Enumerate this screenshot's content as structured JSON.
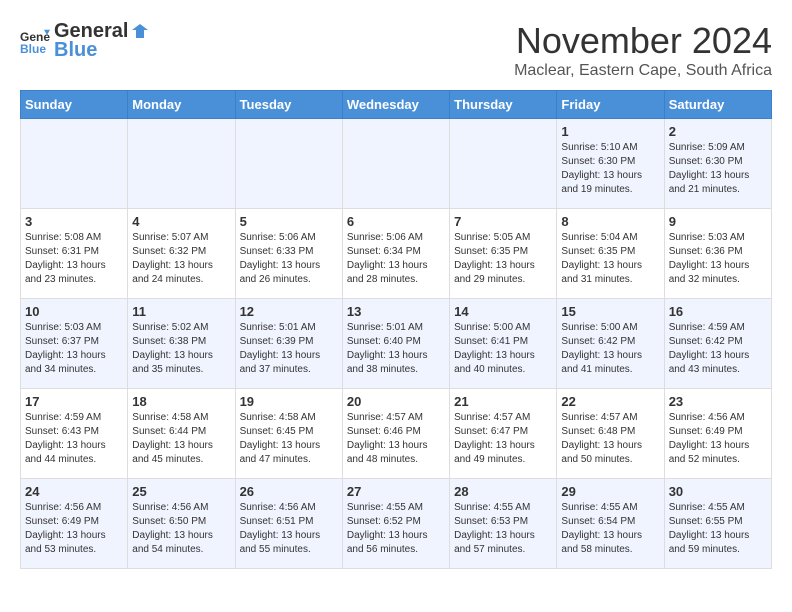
{
  "logo": {
    "general": "General",
    "blue": "Blue"
  },
  "title": "November 2024",
  "subtitle": "Maclear, Eastern Cape, South Africa",
  "weekdays": [
    "Sunday",
    "Monday",
    "Tuesday",
    "Wednesday",
    "Thursday",
    "Friday",
    "Saturday"
  ],
  "weeks": [
    [
      {
        "day": "",
        "info": ""
      },
      {
        "day": "",
        "info": ""
      },
      {
        "day": "",
        "info": ""
      },
      {
        "day": "",
        "info": ""
      },
      {
        "day": "",
        "info": ""
      },
      {
        "day": "1",
        "info": "Sunrise: 5:10 AM\nSunset: 6:30 PM\nDaylight: 13 hours\nand 19 minutes."
      },
      {
        "day": "2",
        "info": "Sunrise: 5:09 AM\nSunset: 6:30 PM\nDaylight: 13 hours\nand 21 minutes."
      }
    ],
    [
      {
        "day": "3",
        "info": "Sunrise: 5:08 AM\nSunset: 6:31 PM\nDaylight: 13 hours\nand 23 minutes."
      },
      {
        "day": "4",
        "info": "Sunrise: 5:07 AM\nSunset: 6:32 PM\nDaylight: 13 hours\nand 24 minutes."
      },
      {
        "day": "5",
        "info": "Sunrise: 5:06 AM\nSunset: 6:33 PM\nDaylight: 13 hours\nand 26 minutes."
      },
      {
        "day": "6",
        "info": "Sunrise: 5:06 AM\nSunset: 6:34 PM\nDaylight: 13 hours\nand 28 minutes."
      },
      {
        "day": "7",
        "info": "Sunrise: 5:05 AM\nSunset: 6:35 PM\nDaylight: 13 hours\nand 29 minutes."
      },
      {
        "day": "8",
        "info": "Sunrise: 5:04 AM\nSunset: 6:35 PM\nDaylight: 13 hours\nand 31 minutes."
      },
      {
        "day": "9",
        "info": "Sunrise: 5:03 AM\nSunset: 6:36 PM\nDaylight: 13 hours\nand 32 minutes."
      }
    ],
    [
      {
        "day": "10",
        "info": "Sunrise: 5:03 AM\nSunset: 6:37 PM\nDaylight: 13 hours\nand 34 minutes."
      },
      {
        "day": "11",
        "info": "Sunrise: 5:02 AM\nSunset: 6:38 PM\nDaylight: 13 hours\nand 35 minutes."
      },
      {
        "day": "12",
        "info": "Sunrise: 5:01 AM\nSunset: 6:39 PM\nDaylight: 13 hours\nand 37 minutes."
      },
      {
        "day": "13",
        "info": "Sunrise: 5:01 AM\nSunset: 6:40 PM\nDaylight: 13 hours\nand 38 minutes."
      },
      {
        "day": "14",
        "info": "Sunrise: 5:00 AM\nSunset: 6:41 PM\nDaylight: 13 hours\nand 40 minutes."
      },
      {
        "day": "15",
        "info": "Sunrise: 5:00 AM\nSunset: 6:42 PM\nDaylight: 13 hours\nand 41 minutes."
      },
      {
        "day": "16",
        "info": "Sunrise: 4:59 AM\nSunset: 6:42 PM\nDaylight: 13 hours\nand 43 minutes."
      }
    ],
    [
      {
        "day": "17",
        "info": "Sunrise: 4:59 AM\nSunset: 6:43 PM\nDaylight: 13 hours\nand 44 minutes."
      },
      {
        "day": "18",
        "info": "Sunrise: 4:58 AM\nSunset: 6:44 PM\nDaylight: 13 hours\nand 45 minutes."
      },
      {
        "day": "19",
        "info": "Sunrise: 4:58 AM\nSunset: 6:45 PM\nDaylight: 13 hours\nand 47 minutes."
      },
      {
        "day": "20",
        "info": "Sunrise: 4:57 AM\nSunset: 6:46 PM\nDaylight: 13 hours\nand 48 minutes."
      },
      {
        "day": "21",
        "info": "Sunrise: 4:57 AM\nSunset: 6:47 PM\nDaylight: 13 hours\nand 49 minutes."
      },
      {
        "day": "22",
        "info": "Sunrise: 4:57 AM\nSunset: 6:48 PM\nDaylight: 13 hours\nand 50 minutes."
      },
      {
        "day": "23",
        "info": "Sunrise: 4:56 AM\nSunset: 6:49 PM\nDaylight: 13 hours\nand 52 minutes."
      }
    ],
    [
      {
        "day": "24",
        "info": "Sunrise: 4:56 AM\nSunset: 6:49 PM\nDaylight: 13 hours\nand 53 minutes."
      },
      {
        "day": "25",
        "info": "Sunrise: 4:56 AM\nSunset: 6:50 PM\nDaylight: 13 hours\nand 54 minutes."
      },
      {
        "day": "26",
        "info": "Sunrise: 4:56 AM\nSunset: 6:51 PM\nDaylight: 13 hours\nand 55 minutes."
      },
      {
        "day": "27",
        "info": "Sunrise: 4:55 AM\nSunset: 6:52 PM\nDaylight: 13 hours\nand 56 minutes."
      },
      {
        "day": "28",
        "info": "Sunrise: 4:55 AM\nSunset: 6:53 PM\nDaylight: 13 hours\nand 57 minutes."
      },
      {
        "day": "29",
        "info": "Sunrise: 4:55 AM\nSunset: 6:54 PM\nDaylight: 13 hours\nand 58 minutes."
      },
      {
        "day": "30",
        "info": "Sunrise: 4:55 AM\nSunset: 6:55 PM\nDaylight: 13 hours\nand 59 minutes."
      }
    ]
  ]
}
